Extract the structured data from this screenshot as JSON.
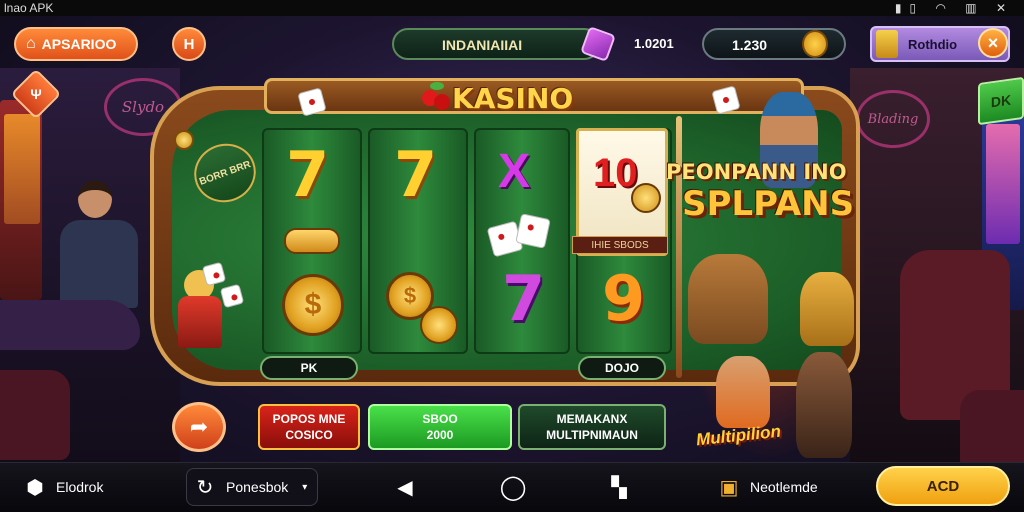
{
  "status_bar": {
    "title": "lnao APK"
  },
  "top_bar": {
    "app_button_label": "APSARIOO",
    "h_button_label": "H",
    "player_name": "INDANIAIIAI",
    "gem_value": "1.0201",
    "coin_value": "1.230",
    "profile_label": "Rothdio",
    "close_label": "×",
    "corner_button_label": "DK"
  },
  "machine": {
    "title": "KASINO",
    "side_sign": "BORR BRR",
    "reel_label": "IHIE SBODS",
    "left_bet_label": "PK",
    "right_bet_label": "DOJO"
  },
  "reels": [
    {
      "top": "7",
      "middle": "bar",
      "bottom": "$"
    },
    {
      "top": "7",
      "bottom": "$"
    },
    {
      "top": "X",
      "middle": "dice",
      "bottom": "7"
    },
    {
      "top": "10",
      "bottom": "9"
    }
  ],
  "promo": {
    "title_line1": "PEONPANN INO",
    "title_line2": "SPLPANS",
    "multiplier_tag": "Multipilion"
  },
  "neon_signs": {
    "left": "Slydo",
    "right": "Blading"
  },
  "action_buttons": {
    "red": {
      "line1": "POPOS MNE",
      "line2": "COSICO"
    },
    "green": {
      "line1": "SBOO",
      "line2": "2000"
    },
    "dark": {
      "line1": "MEMAKANX",
      "line2": "MULTIPNIMAUN"
    }
  },
  "bottom_nav": {
    "left_label": "Elodrok",
    "dropdown_label": "Ponesbok",
    "right_label": "Neotlemde",
    "add_button_label": "ACD"
  },
  "icons": {
    "home": "home-icon",
    "share": "share-icon",
    "back": "back-triangle-icon",
    "home_circle": "home-circle-icon",
    "recents": "recents-icon"
  },
  "colors": {
    "accent_orange": "#ff8a3a",
    "gold": "#ffd54a",
    "felt_green": "#2f8a3e",
    "action_red": "#d8241a",
    "action_green": "#4ae04a"
  }
}
